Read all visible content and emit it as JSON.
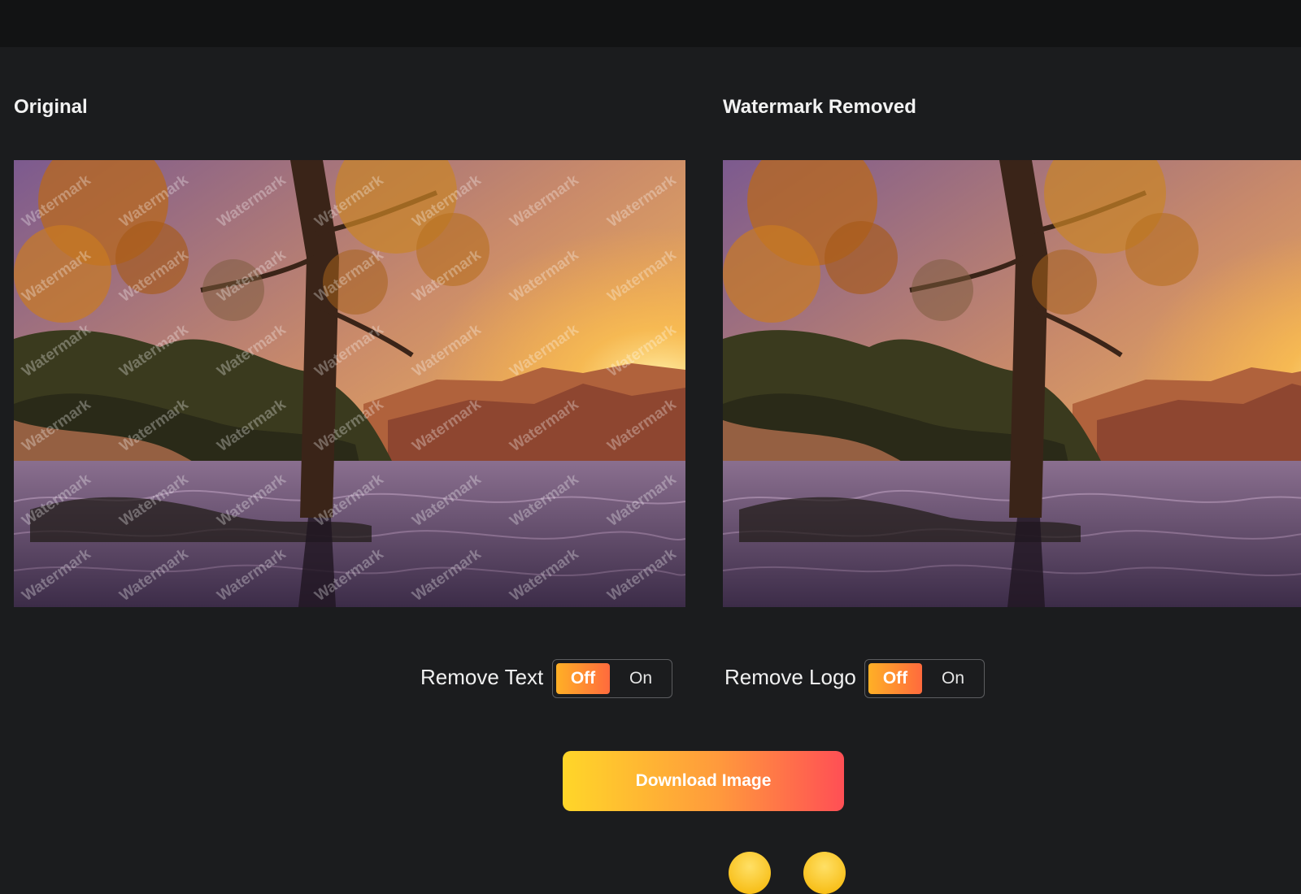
{
  "original": {
    "title": "Original",
    "watermark_text": "Watermark"
  },
  "result": {
    "title": "Watermark Removed"
  },
  "remove_text": {
    "label": "Remove Text",
    "off": "Off",
    "on": "On",
    "selected": "Off"
  },
  "remove_logo": {
    "label": "Remove Logo",
    "off": "Off",
    "on": "On",
    "selected": "Off"
  },
  "download": {
    "label": "Download Image"
  },
  "colors": {
    "background": "#1b1c1e",
    "topbar": "#121314",
    "accent_start": "#ffd629",
    "accent_end": "#ff4f55"
  },
  "icons": [
    "emoji-icon",
    "emoji-icon"
  ]
}
